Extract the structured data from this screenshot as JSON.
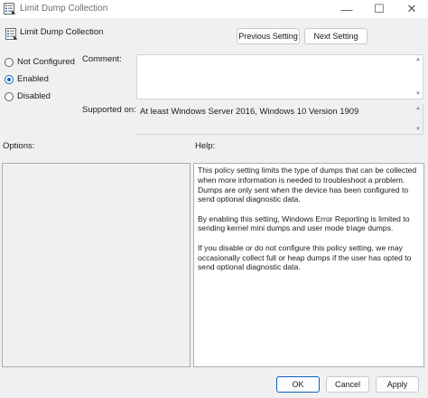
{
  "window": {
    "title": "Limit Dump Collection",
    "min_glyph": "—",
    "max_glyph": "☐",
    "close_glyph": "✕"
  },
  "header": {
    "policy_name": "Limit Dump Collection",
    "prev_label": "Previous Setting",
    "next_label": "Next Setting"
  },
  "state": {
    "options": [
      {
        "label": "Not Configured",
        "selected": false
      },
      {
        "label": "Enabled",
        "selected": true
      },
      {
        "label": "Disabled",
        "selected": false
      }
    ]
  },
  "comment": {
    "label": "Comment:",
    "value": ""
  },
  "supported": {
    "label": "Supported on:",
    "value": "At least Windows Server 2016, Windows 10 Version 1909"
  },
  "options_pane": {
    "label": "Options:"
  },
  "help_pane": {
    "label": "Help:",
    "paragraphs": [
      "This policy setting limits the type of dumps that can be collected when more information is needed to troubleshoot a problem. Dumps are only sent when the device has been configured to send optional diagnostic data.",
      "By enabling this setting, Windows Error Reporting is limited to sending kernel mini dumps and user mode triage dumps.",
      "If you disable or do not configure this policy setting, we may occasionally collect full or heap dumps if the user has opted to send optional diagnostic data."
    ]
  },
  "footer": {
    "ok_label": "OK",
    "cancel_label": "Cancel",
    "apply_label": "Apply"
  },
  "colors": {
    "accent": "#1565c0",
    "ok_border": "#0b62c4",
    "dialog_bg": "#f0f0f0"
  },
  "icons": {
    "app": "policy-settings-icon"
  }
}
